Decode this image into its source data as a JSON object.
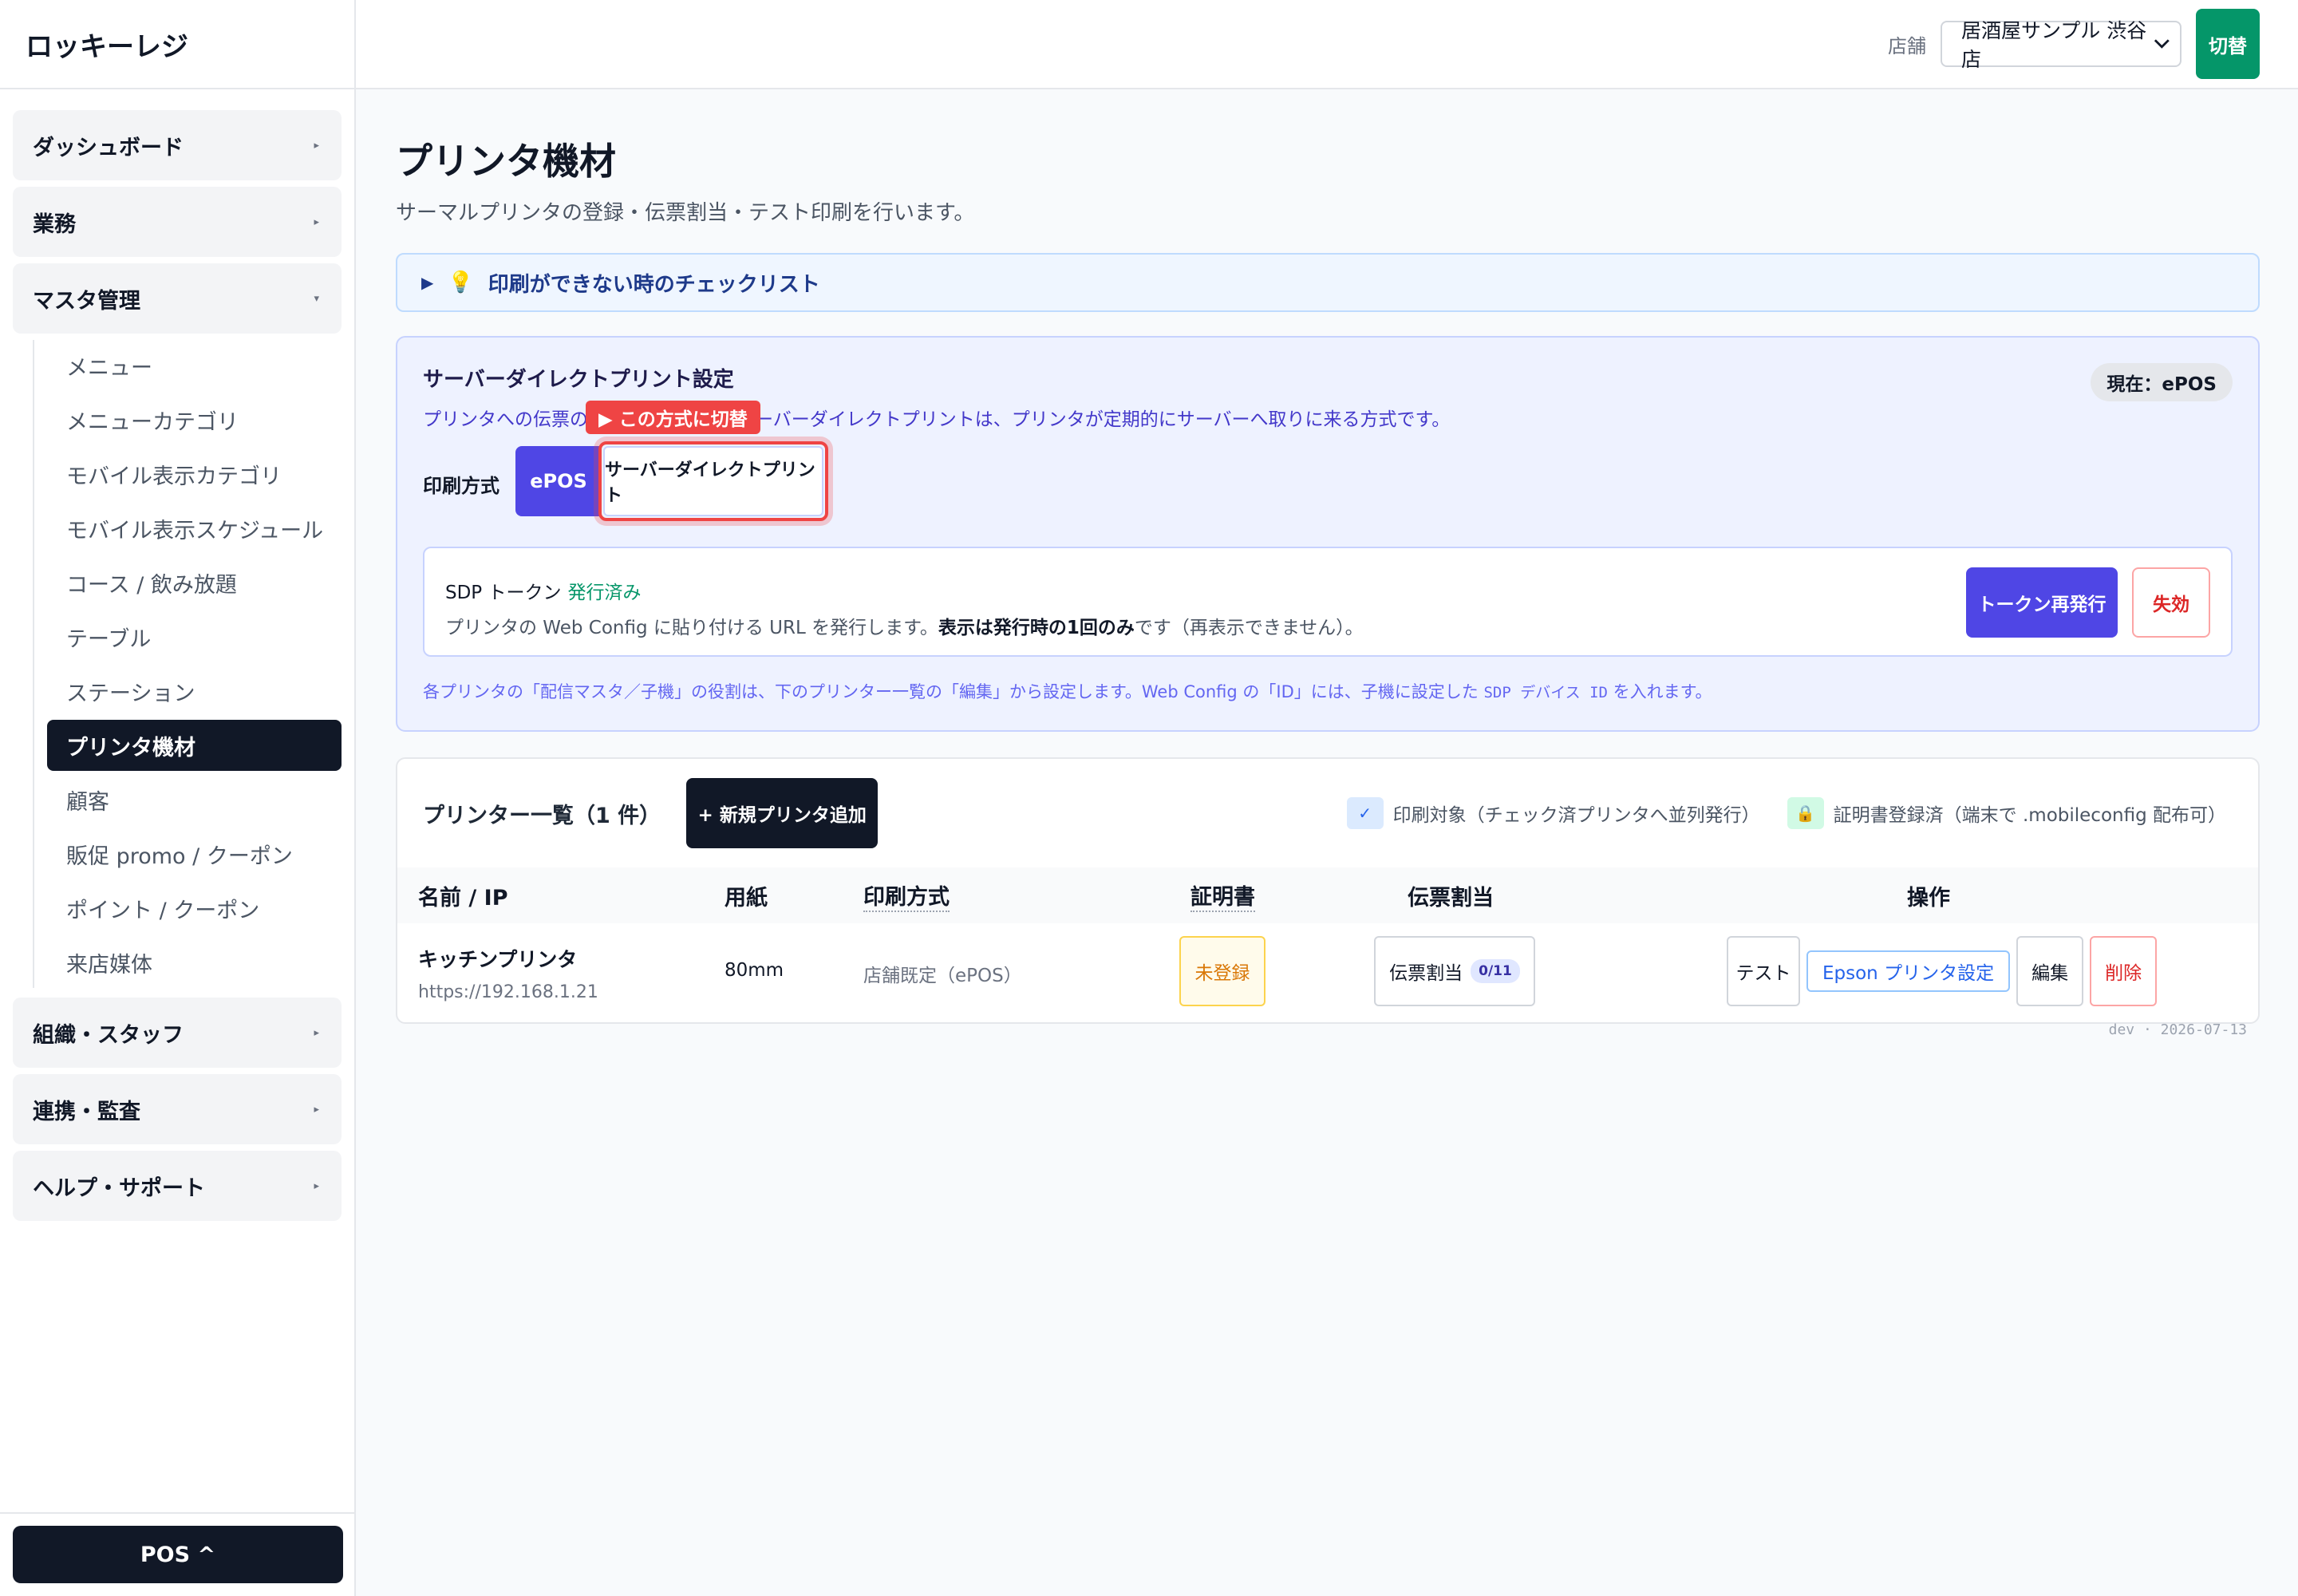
{
  "app": {
    "name": "ロッキーレジ"
  },
  "sidebar": {
    "groups": [
      {
        "label": "ダッシュボード",
        "caret": "▸"
      },
      {
        "label": "業務",
        "caret": "▸"
      },
      {
        "label": "マスタ管理",
        "caret": "▾"
      },
      {
        "label": "組織・スタッフ",
        "caret": "▸"
      },
      {
        "label": "連携・監査",
        "caret": "▸"
      },
      {
        "label": "ヘルプ・サポート",
        "caret": "▸"
      }
    ],
    "master_items": [
      "メニュー",
      "メニューカテゴリ",
      "モバイル表示カテゴリ",
      "モバイル表示スケジュール",
      "コース / 飲み放題",
      "テーブル",
      "ステーション",
      "プリンタ機材",
      "顧客",
      "販促 promo / クーポン",
      "ポイント / クーポン",
      "来店媒体"
    ],
    "active_item": "プリンタ機材",
    "pos_button": "POS ^"
  },
  "topbar": {
    "store_label": "店舗",
    "store_selected": "居酒屋サンプル 渋谷店",
    "switch_label": "切替"
  },
  "page": {
    "title": "プリンタ機材",
    "subtitle": "サーマルプリンタの登録・伝票割当・テスト印刷を行います。",
    "checklist": {
      "triangle": "▶",
      "icon": "💡",
      "label": "印刷ができない時のチェックリスト"
    }
  },
  "sdp": {
    "title": "サーバーダイレクトプリント設定",
    "desc_a": "プリンタへの伝票の届",
    "desc_b": "ーバーダイレクトプリントは、プリンタが定期的にサーバーへ取りに来る方式です。",
    "current_badge": "現在：ePOS",
    "method_label": "印刷方式",
    "method_epos": "ePOS",
    "method_sdp": "サーバーダイレクトプリント",
    "tooltip": "▶ この方式に切替",
    "token": {
      "title": "SDP トークン",
      "status": "発行済み",
      "desc_a": "プリンタの Web Config に貼り付ける URL を発行します。",
      "desc_b": "表示は発行時の1回のみ",
      "desc_c": "です（再表示できません）。",
      "reissue": "トークン再発行",
      "revoke": "失効"
    },
    "note_a": "各プリンタの「配信マスタ／子機」の役割は、下のプリンター一覧の「編集」から設定します。Web Config の「ID」には、子機に設定した ",
    "note_code": "SDP デバイス ID",
    "note_b": " を入れます。"
  },
  "printers": {
    "title": "プリンター一覧（1 件）",
    "add_button": "+ 新規プリンタ追加",
    "legend": {
      "check_icon": "✓",
      "check_label": "印刷対象（チェック済プリンタへ並列発行）",
      "lock_icon": "🔒",
      "lock_label": "証明書登録済（端末で .mobileconfig 配布可）"
    },
    "columns": [
      "名前 / IP",
      "用紙",
      "印刷方式",
      "証明書",
      "伝票割当",
      "操作"
    ],
    "rows": [
      {
        "name": "キッチンプリンタ",
        "ip": "https://192.168.1.21",
        "paper": "80mm",
        "method": "店舗既定（ePOS）",
        "cert": "未登録",
        "assign_label": "伝票割当",
        "assign_count": "0/11",
        "ops": {
          "test": "テスト",
          "epson": "Epson プリンタ設定",
          "edit": "編集",
          "delete": "削除"
        }
      }
    ]
  },
  "footer": {
    "version": "dev · 2026-07-13"
  },
  "colors": {
    "accent": "#4f46e5",
    "dark": "#111827",
    "success": "#059669",
    "danger": "#ef4444"
  }
}
